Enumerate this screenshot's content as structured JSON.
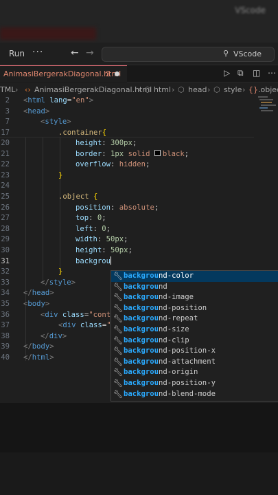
{
  "top_blurred": {
    "app_label": "VScode"
  },
  "titlebar": {
    "run_label": "Run",
    "more_label": "···",
    "back_glyph": "←",
    "forward_glyph": "→",
    "search_text": "VScode"
  },
  "tab": {
    "filename": "AnimasiBergerakDiagonal.html",
    "problem_count": "2"
  },
  "breadcrumb": {
    "items": [
      "TML",
      "AnimasiBergerakDiagonal.html",
      "html",
      "head",
      "style",
      ".object"
    ]
  },
  "editor": {
    "sticky_lines": [
      {
        "num": "2",
        "code": "<html lang=\"en\">"
      },
      {
        "num": "3",
        "code": "<head>"
      },
      {
        "num": "7",
        "code": "<style>"
      },
      {
        "num": "17",
        "code": ".container{"
      }
    ],
    "lines": [
      {
        "num": "20",
        "code": "height: 300px;"
      },
      {
        "num": "21",
        "code": "border: 1px solid black;"
      },
      {
        "num": "22",
        "code": "overflow: hidden;"
      },
      {
        "num": "23",
        "code": "}"
      },
      {
        "num": "24",
        "code": ""
      },
      {
        "num": "25",
        "code": ".object {"
      },
      {
        "num": "26",
        "code": "position: absolute;"
      },
      {
        "num": "27",
        "code": "top: 0;"
      },
      {
        "num": "28",
        "code": "left: 0;"
      },
      {
        "num": "29",
        "code": "width: 50px;"
      },
      {
        "num": "30",
        "code": "height: 50px;"
      },
      {
        "num": "31",
        "code": "backgrou"
      },
      {
        "num": "32",
        "code": "}"
      },
      {
        "num": "33",
        "code": "</style>"
      },
      {
        "num": "34",
        "code": "</head>"
      },
      {
        "num": "35",
        "code": "<body>"
      },
      {
        "num": "36",
        "code": "<div class=\"cont"
      },
      {
        "num": "37",
        "code": "<div class=\""
      },
      {
        "num": "38",
        "code": "</div>"
      },
      {
        "num": "39",
        "code": "</body>"
      },
      {
        "num": "40",
        "code": "</html>"
      }
    ]
  },
  "suggestions": {
    "typed": "backgrou",
    "items": [
      "background-color",
      "background",
      "background-image",
      "background-position",
      "background-repeat",
      "background-size",
      "background-clip",
      "background-position-x",
      "background-attachment",
      "background-origin",
      "background-position-y",
      "background-blend-mode"
    ]
  },
  "colors": {
    "accent": "#2aaaff",
    "selection": "#04395e",
    "tab_error": "#e0876f"
  }
}
